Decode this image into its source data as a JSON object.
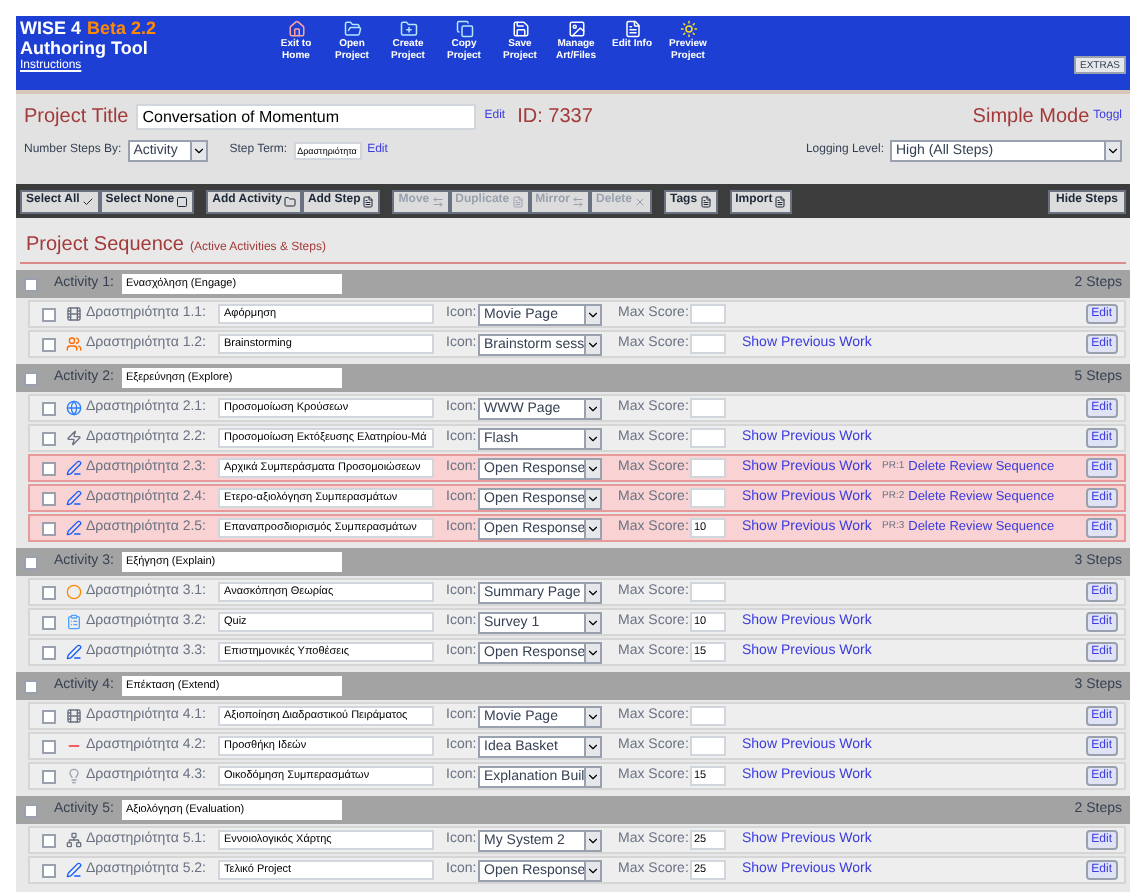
{
  "header": {
    "product": "WISE 4",
    "beta": "Beta 2.2",
    "subtitle": "Authoring Tool",
    "instructions_link": "Instructions",
    "extras": "EXTRAS",
    "nav": [
      {
        "kind": "home",
        "label": "Exit to Home"
      },
      {
        "kind": "open",
        "label": "Open Project"
      },
      {
        "kind": "create",
        "label": "Create Project"
      },
      {
        "kind": "copy",
        "label": "Copy Project"
      },
      {
        "kind": "save",
        "label": "Save Project"
      },
      {
        "kind": "files",
        "label": "Manage Art/Files"
      },
      {
        "kind": "info",
        "label": "Edit Info"
      },
      {
        "kind": "preview",
        "label": "Preview Project"
      }
    ]
  },
  "project": {
    "title_label": "Project Title",
    "title": "Conversation of Momentum",
    "edit": "Edit",
    "id": "ID: 7337",
    "mode": "Simple Mode",
    "toggle": "Toggl"
  },
  "settings": {
    "number_by_label": "Number Steps By:",
    "number_by": "Activity",
    "step_term_label": "Step Term:",
    "step_term": "Δραστηριότητα",
    "step_term_edit": "Edit",
    "logging_label": "Logging Level:",
    "logging": "High (All Steps)"
  },
  "toolbar": [
    [
      {
        "label": "Select All",
        "kind": "check",
        "disabled": false
      },
      {
        "label": "Select None",
        "kind": "square",
        "disabled": false
      }
    ],
    [
      {
        "label": "Add Activity",
        "kind": "folder",
        "disabled": false
      },
      {
        "label": "Add Step",
        "kind": "doc",
        "disabled": false
      }
    ],
    [
      {
        "label": "Move",
        "kind": "arrow",
        "disabled": true
      },
      {
        "label": "Duplicate",
        "kind": "doc",
        "disabled": true
      },
      {
        "label": "Mirror",
        "kind": "arrow",
        "disabled": true
      },
      {
        "label": "Delete",
        "kind": "x",
        "disabled": true
      }
    ],
    [
      {
        "label": "Tags",
        "kind": "doc",
        "disabled": false
      }
    ],
    [
      {
        "label": "Import",
        "kind": "doc",
        "disabled": false
      }
    ]
  ],
  "hide_steps": "Hide Steps",
  "sequence": {
    "title": "Project Sequence",
    "subtitle": "(Active Activities & Steps)",
    "activities": [
      {
        "label": "Activity 1:",
        "title": "Ενασχόληση (Engage)",
        "count": "2 Steps",
        "checked": false,
        "steps": [
          {
            "kind": "movie",
            "label": "Δραστηριότητα 1.1:",
            "title": "Αφόρμηση",
            "icon_label": "Icon:",
            "type": "Movie Page",
            "max_score_label": "Max Score:",
            "edit": "Edit",
            "checked": false,
            "review": false
          },
          {
            "kind": "brainstorm",
            "label": "Δραστηριότητα 1.2:",
            "title": "Brainstorming",
            "icon_label": "Icon:",
            "type": "Brainstorm sess",
            "max_score_label": "Max Score:",
            "edit": "Edit",
            "checked": false,
            "review": false,
            "previous": "Show Previous Work"
          }
        ]
      },
      {
        "label": "Activity 2:",
        "title": "Εξερεύνηση (Explore)",
        "count": "5 Steps",
        "checked": false,
        "steps": [
          {
            "kind": "www",
            "label": "Δραστηριότητα 2.1:",
            "title": "Προσομοίωση Κρούσεων",
            "icon_label": "Icon:",
            "type": "WWW Page",
            "max_score_label": "Max Score:",
            "edit": "Edit",
            "checked": false,
            "review": false
          },
          {
            "kind": "flash",
            "label": "Δραστηριότητα 2.2:",
            "title": "Προσομοίωση Εκτόξευσης Ελατηρίου-Μά",
            "icon_label": "Icon:",
            "type": "Flash",
            "max_score_label": "Max Score:",
            "edit": "Edit",
            "checked": false,
            "review": false,
            "previous": "Show Previous Work"
          },
          {
            "kind": "open",
            "label": "Δραστηριότητα 2.3:",
            "title": "Αρχικά Συμπεράσματα Προσομοιώσεων",
            "icon_label": "Icon:",
            "type": "Open Response",
            "max_score_label": "Max Score:",
            "edit": "Edit",
            "checked": false,
            "review": true,
            "previous": "Show Previous Work",
            "review_label": "PR:1",
            "review_action": "Delete Review Sequence"
          },
          {
            "kind": "open",
            "label": "Δραστηριότητα 2.4:",
            "title": "Ετερο-αξιολόγηση Συμπερασμάτων",
            "icon_label": "Icon:",
            "type": "Open Response",
            "max_score_label": "Max Score:",
            "edit": "Edit",
            "checked": false,
            "review": true,
            "previous": "Show Previous Work",
            "review_label": "PR:2",
            "review_action": "Delete Review Sequence"
          },
          {
            "kind": "open",
            "label": "Δραστηριότητα 2.5:",
            "title": "Επαναπροσδιορισμός Συμπερασμάτων",
            "icon_label": "Icon:",
            "type": "Open Response",
            "max_score_label": "Max Score:",
            "score": "10",
            "edit": "Edit",
            "checked": false,
            "review": true,
            "previous": "Show Previous Work",
            "review_label": "PR:3",
            "review_action": "Delete Review Sequence"
          }
        ]
      },
      {
        "label": "Activity 3:",
        "title": "Εξήγηση (Explain)",
        "count": "3 Steps",
        "checked": false,
        "steps": [
          {
            "kind": "summary",
            "label": "Δραστηριότητα 3.1:",
            "title": "Ανασκόπηση Θεωρίας",
            "icon_label": "Icon:",
            "type": "Summary Page",
            "max_score_label": "Max Score:",
            "edit": "Edit",
            "checked": false,
            "review": false
          },
          {
            "kind": "survey",
            "label": "Δραστηριότητα 3.2:",
            "title": "Quiz",
            "icon_label": "Icon:",
            "type": "Survey 1",
            "max_score_label": "Max Score:",
            "score": "10",
            "edit": "Edit",
            "checked": false,
            "review": false,
            "previous": "Show Previous Work"
          },
          {
            "kind": "open",
            "label": "Δραστηριότητα 3.3:",
            "title": "Επιστημονικές Υποθέσεις",
            "icon_label": "Icon:",
            "type": "Open Response",
            "max_score_label": "Max Score:",
            "score": "15",
            "edit": "Edit",
            "checked": false,
            "review": false,
            "previous": "Show Previous Work"
          }
        ]
      },
      {
        "label": "Activity 4:",
        "title": "Επέκταση (Extend)",
        "count": "3 Steps",
        "checked": false,
        "steps": [
          {
            "kind": "movie",
            "label": "Δραστηριότητα 4.1:",
            "title": "Αξιοποίηση Διαδραστικού Πειράματος",
            "icon_label": "Icon:",
            "type": "Movie Page",
            "max_score_label": "Max Score:",
            "edit": "Edit",
            "checked": false,
            "review": false
          },
          {
            "kind": "idea",
            "label": "Δραστηριότητα 4.2:",
            "title": "Προσθήκη Ιδεών",
            "icon_label": "Icon:",
            "type": "Idea Basket",
            "max_score_label": "Max Score:",
            "edit": "Edit",
            "checked": false,
            "review": false,
            "previous": "Show Previous Work"
          },
          {
            "kind": "explanation",
            "label": "Δραστηριότητα 4.3:",
            "title": "Οικοδόμηση Συμπερασμάτων",
            "icon_label": "Icon:",
            "type": "Explanation Buil",
            "max_score_label": "Max Score:",
            "score": "15",
            "edit": "Edit",
            "checked": false,
            "review": false,
            "previous": "Show Previous Work"
          }
        ]
      },
      {
        "label": "Activity 5:",
        "title": "Αξιολόγηση (Evaluation)",
        "count": "2 Steps",
        "checked": false,
        "steps": [
          {
            "kind": "mysystem",
            "label": "Δραστηριότητα 5.1:",
            "title": "Εννοιολογικός Χάρτης",
            "icon_label": "Icon:",
            "type": "My System 2",
            "max_score_label": "Max Score:",
            "score": "25",
            "edit": "Edit",
            "checked": false,
            "review": false,
            "previous": "Show Previous Work"
          },
          {
            "kind": "open",
            "label": "Δραστηριότητα 5.2:",
            "title": "Τελικό Project",
            "icon_label": "Icon:",
            "type": "Open Response",
            "max_score_label": "Max Score:",
            "score": "25",
            "edit": "Edit",
            "checked": false,
            "review": false,
            "previous": "Show Previous Work"
          }
        ]
      }
    ]
  }
}
